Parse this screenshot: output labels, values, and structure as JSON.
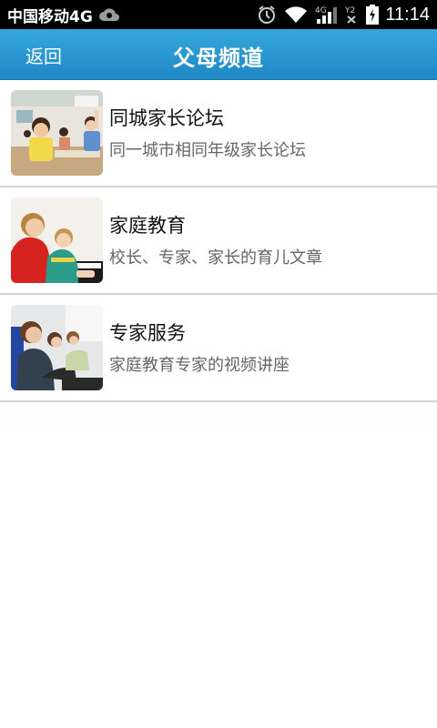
{
  "status_bar": {
    "carrier": "中国移动4G",
    "time": "11:14",
    "icons": [
      "cloud-icon",
      "alarm-icon",
      "wifi-icon",
      "signal-4g-icon",
      "signal-2-icon",
      "battery-charging-icon"
    ]
  },
  "header": {
    "back_label": "返回",
    "title": "父母频道"
  },
  "items": [
    {
      "title": "同城家长论坛",
      "subtitle": "同一城市相同年级家长论坛",
      "thumb": "classroom-students-image"
    },
    {
      "title": "家庭教育",
      "subtitle": "校长、专家、家长的育儿文章",
      "thumb": "piano-lesson-image"
    },
    {
      "title": "专家服务",
      "subtitle": "家庭教育专家的视频讲座",
      "thumb": "lecture-audience-image"
    }
  ],
  "colors": {
    "header_top": "#35a7dd",
    "header_bottom": "#1f88c6",
    "divider": "#d2d2d2"
  }
}
